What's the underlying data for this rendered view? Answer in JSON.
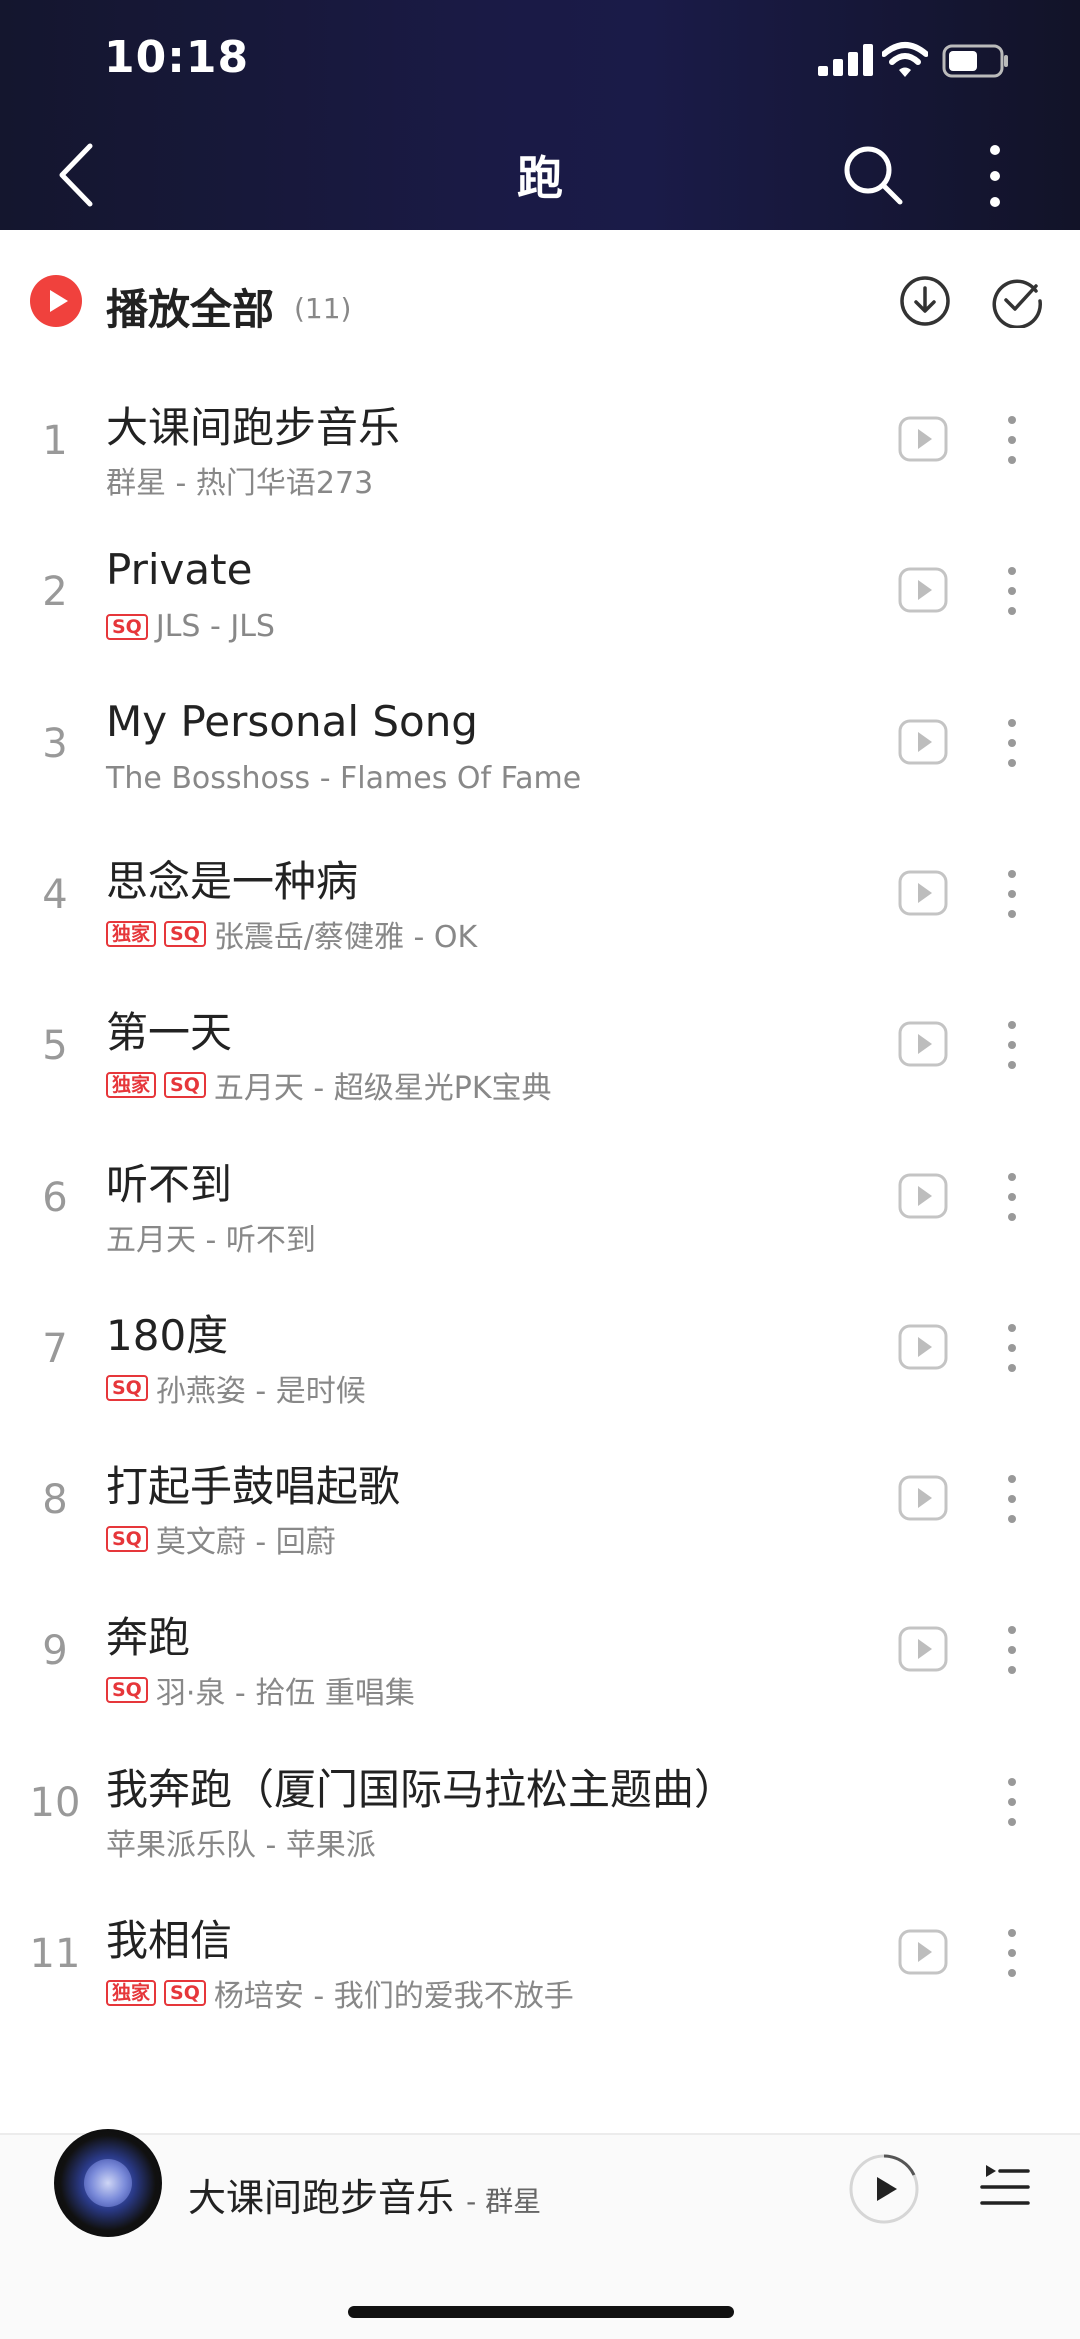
{
  "status": {
    "time": "10:18"
  },
  "header": {
    "title": "跑"
  },
  "play_all": {
    "label": "播放全部",
    "count": "(11)"
  },
  "songs": [
    {
      "num": "1",
      "name": "大课间跑步音乐",
      "tags": [],
      "meta": "群星 - 热门华语273",
      "has_play": true
    },
    {
      "num": "2",
      "name": "Private",
      "tags": [
        "SQ"
      ],
      "meta": "JLS - JLS",
      "has_play": true
    },
    {
      "num": "3",
      "name": "My Personal Song",
      "tags": [],
      "meta": "The Bosshoss - Flames Of Fame",
      "has_play": true
    },
    {
      "num": "4",
      "name": "思念是一种病",
      "tags": [
        "独家",
        "SQ"
      ],
      "meta": "张震岳/蔡健雅 - OK",
      "has_play": true
    },
    {
      "num": "5",
      "name": "第一天",
      "tags": [
        "独家",
        "SQ"
      ],
      "meta": "五月天 - 超级星光PK宝典",
      "has_play": true
    },
    {
      "num": "6",
      "name": "听不到",
      "tags": [],
      "meta": "五月天 - 听不到",
      "has_play": true
    },
    {
      "num": "7",
      "name": "180度",
      "tags": [
        "SQ"
      ],
      "meta": "孙燕姿 - 是时候",
      "has_play": true
    },
    {
      "num": "8",
      "name": "打起手鼓唱起歌",
      "tags": [
        "SQ"
      ],
      "meta": "莫文蔚 - 回蔚",
      "has_play": true
    },
    {
      "num": "9",
      "name": "奔跑",
      "tags": [
        "SQ"
      ],
      "meta": "羽·泉 - 拾伍 重唱集",
      "has_play": true
    },
    {
      "num": "10",
      "name": "我奔跑（厦门国际马拉松主题曲）",
      "tags": [],
      "meta": "苹果派乐队 - 苹果派",
      "has_play": false
    },
    {
      "num": "11",
      "name": "我相信",
      "tags": [
        "独家",
        "SQ"
      ],
      "meta": "杨培安 - 我们的爱我不放手",
      "has_play": true
    }
  ],
  "now_playing": {
    "title": "大课间跑步音乐",
    "artist": "- 群星"
  },
  "colors": {
    "accent": "#e6363a",
    "header_bg": "#1a1a45"
  },
  "icons": {
    "back": "chevron-left-icon",
    "search": "search-icon",
    "more": "more-vertical-icon",
    "play_all": "play-circle-icon",
    "download": "download-icon",
    "select": "check-circle-icon",
    "row_play": "play-video-icon",
    "row_more": "more-vertical-icon",
    "playlist": "playlist-icon"
  }
}
